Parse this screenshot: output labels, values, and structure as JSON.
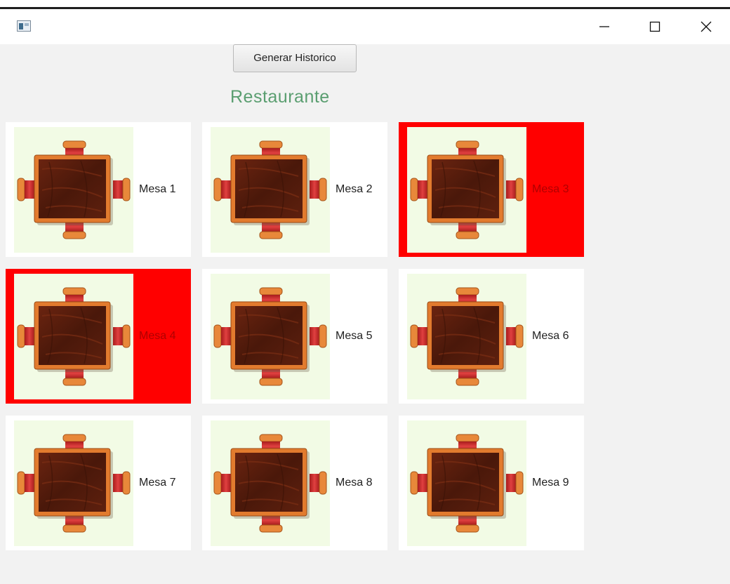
{
  "window": {
    "icon": "app-window-icon",
    "controls": [
      "minimize-icon",
      "maximize-icon",
      "close-icon"
    ]
  },
  "toolbar": {
    "generate_history_label": "Generar Historico"
  },
  "header": {
    "title": "Restaurante",
    "title_color": "#5a9e70"
  },
  "colors": {
    "free": "#ffffff",
    "occupied": "#ff0000",
    "image_bg": "#f2fbe5"
  },
  "tables": [
    {
      "label": "Mesa 1",
      "status": "free"
    },
    {
      "label": "Mesa 2",
      "status": "free"
    },
    {
      "label": "Mesa 3",
      "status": "occupied"
    },
    {
      "label": "Mesa 4",
      "status": "occupied"
    },
    {
      "label": "Mesa 5",
      "status": "free"
    },
    {
      "label": "Mesa 6",
      "status": "free"
    },
    {
      "label": "Mesa 7",
      "status": "free"
    },
    {
      "label": "Mesa 8",
      "status": "free"
    },
    {
      "label": "Mesa 9",
      "status": "free"
    }
  ]
}
